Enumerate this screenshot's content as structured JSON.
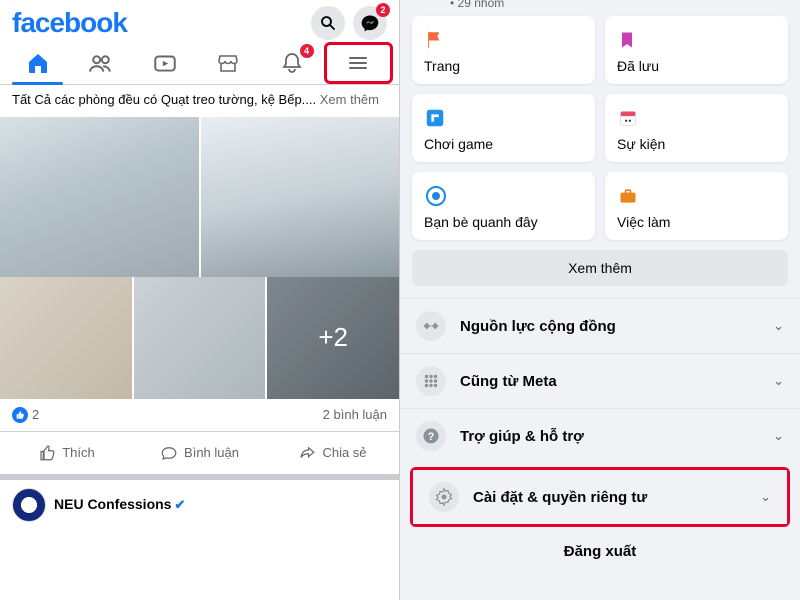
{
  "left": {
    "logo": "facebook",
    "badges": {
      "messenger": "2",
      "notifications": "4"
    },
    "post": {
      "text_prefix": "Tất Cả các phòng đều có Quạt treo tường, kệ Bếp.... ",
      "see_more": "Xem thêm",
      "more_photos": "+2",
      "like_count": "2",
      "comment_count": "2 bình luận"
    },
    "actions": {
      "like": "Thích",
      "comment": "Bình luận",
      "share": "Chia sẻ"
    },
    "next_post_page": "NEU Confessions"
  },
  "right": {
    "stub_count": "29 nhóm",
    "cards": {
      "pages": "Trang",
      "saved": "Đã lưu",
      "gaming": "Chơi game",
      "events": "Sự kiện",
      "nearby": "Bạn bè quanh đây",
      "jobs": "Việc làm"
    },
    "see_more": "Xem thêm",
    "options": {
      "community": "Nguồn lực cộng đồng",
      "meta": "Cũng từ Meta",
      "help": "Trợ giúp & hỗ trợ",
      "settings": "Cài đặt & quyền riêng tư"
    },
    "logout": "Đăng xuất"
  }
}
